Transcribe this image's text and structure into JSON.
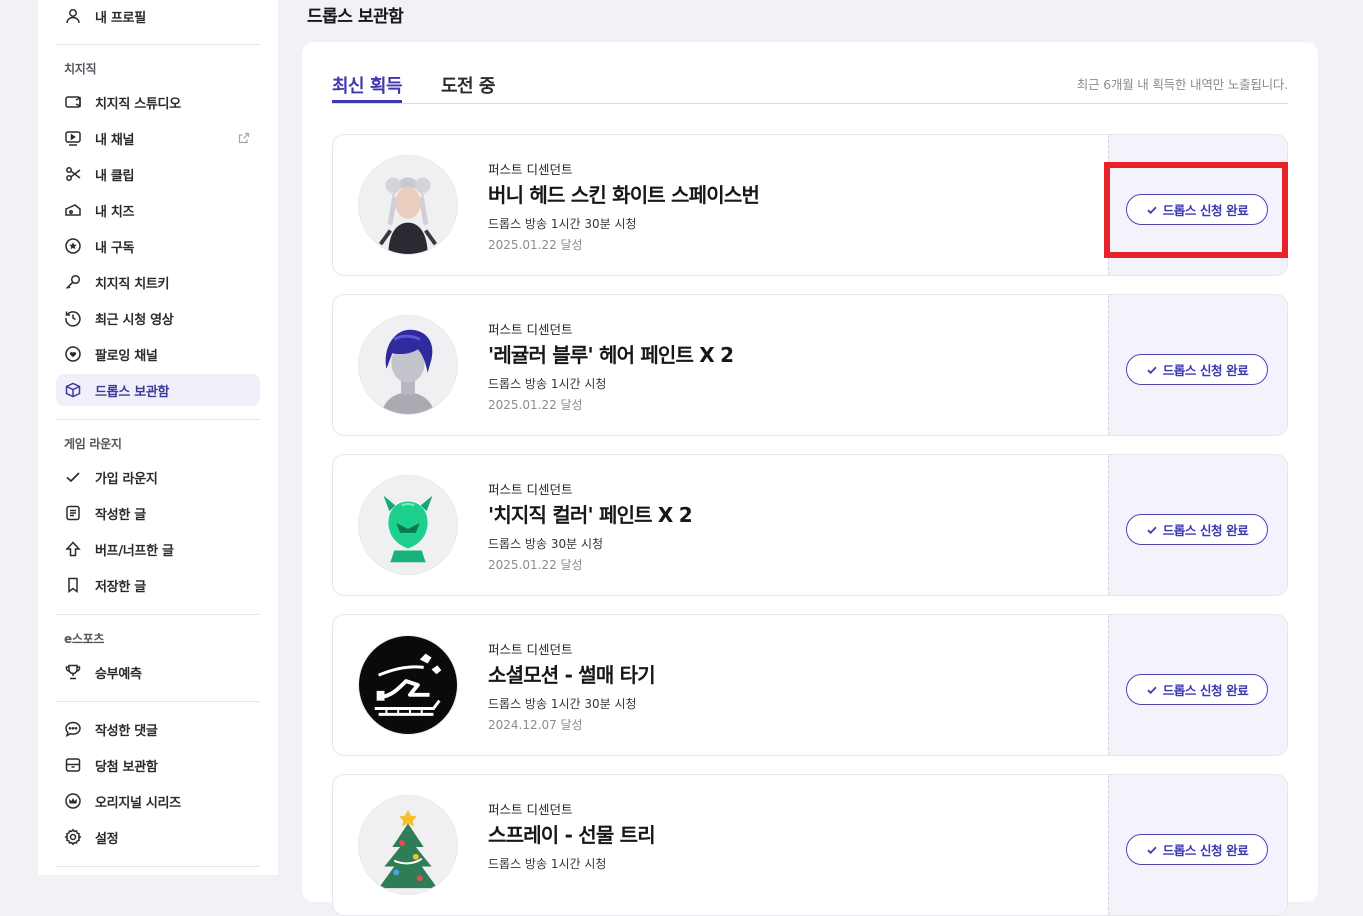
{
  "sidebar": {
    "profile": "내 프로필",
    "chzzk_heading": "치지직",
    "chzzk_items": [
      "치지직 스튜디오",
      "내 채널",
      "내 클립",
      "내 치즈",
      "내 구독",
      "치지직 치트키",
      "최근 시청 영상",
      "팔로잉 채널",
      "드롭스 보관함"
    ],
    "lounge_heading": "게임 라운지",
    "lounge_items": [
      "가입 라운지",
      "작성한 글",
      "버프/너프한 글",
      "저장한 글"
    ],
    "esports_heading": "e스포츠",
    "esports_items": [
      "승부예측"
    ],
    "misc_items": [
      "작성한 댓글",
      "당첨 보관함",
      "오리지널 시리즈",
      "설정"
    ],
    "active_item": "드롭스 보관함"
  },
  "page": {
    "title": "드롭스 보관함",
    "tabs": [
      "최신 획득",
      "도전 중"
    ],
    "active_tab": "최신 획득",
    "note": "최근 6개월 내 획득한 내역만 노출됩니다."
  },
  "drops": [
    {
      "game": "퍼스트 디센던트",
      "title": "버니 헤드 스킨 화이트 스페이스번",
      "condition": "드롭스 방송 1시간 30분 시청",
      "date": "2025.01.22 달성",
      "button": "드롭스 신청 완료",
      "thumb": "character-portrait-icon"
    },
    {
      "game": "퍼스트 디센던트",
      "title": "'레귤러 블루' 헤어 페인트 X 2",
      "condition": "드롭스 방송 1시간 시청",
      "date": "2025.01.22 달성",
      "button": "드롭스 신청 완료",
      "thumb": "blue-hair-icon"
    },
    {
      "game": "퍼스트 디센던트",
      "title": "'치지직 컬러' 페인트 X 2",
      "condition": "드롭스 방송 30분 시청",
      "date": "2025.01.22 달성",
      "button": "드롭스 신청 완료",
      "thumb": "green-helmet-icon"
    },
    {
      "game": "퍼스트 디센던트",
      "title": "소셜모션 - 썰매 타기",
      "condition": "드롭스 방송 1시간 30분 시청",
      "date": "2024.12.07 달성",
      "button": "드롭스 신청 완료",
      "thumb": "sled-icon"
    },
    {
      "game": "퍼스트 디센던트",
      "title": "스프레이 - 선물 트리",
      "condition": "드롭스 방송 1시간 시청",
      "date": "",
      "button": "드롭스 신청 완료",
      "thumb": "christmas-tree-icon"
    }
  ],
  "colors": {
    "accent": "#3d37b0",
    "highlight": "#e8222b",
    "claim_bg": "#f4f3fc"
  }
}
